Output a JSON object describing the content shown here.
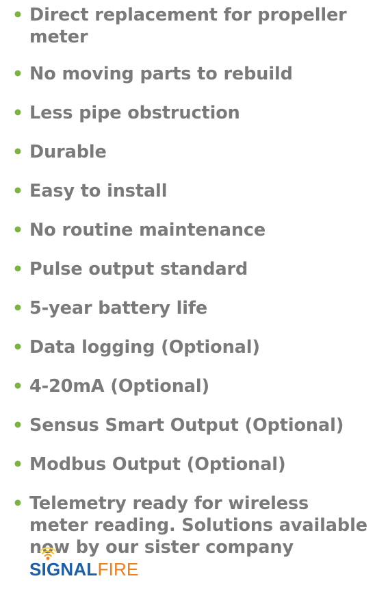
{
  "features": [
    "Direct replacement for propeller meter",
    "No moving parts to rebuild",
    "Less pipe obstruction",
    "Durable",
    "Easy to install",
    "No routine maintenance",
    "Pulse output standard",
    "5-year battery life",
    "Data logging (Optional)",
    "4-20mA (Optional)",
    "Sensus Smart Output (Optional)",
    "Modbus Output (Optional)"
  ],
  "telemetry": {
    "text": "Telemetry ready for wireless meter reading. Solutions available now by our sister company ",
    "brand_signal": "SIGNAL",
    "brand_fire": "FIRE"
  },
  "bullet_glyph": "•",
  "colors": {
    "text": "#7a7a7a",
    "bullet": "#7bb241",
    "brand_signal": "#1e5ea8",
    "brand_fire": "#f07d1a"
  },
  "icons": {
    "brand": "signal-waves-icon"
  }
}
